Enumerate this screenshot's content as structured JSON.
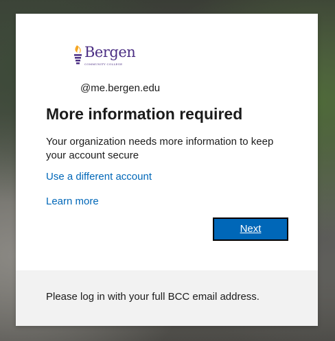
{
  "logo": {
    "name": "Bergen",
    "subtitle": "COMMUNITY COLLEGE",
    "brand_color": "#4b2e83",
    "flame_color": "#f5a623"
  },
  "account": {
    "email": "@me.bergen.edu"
  },
  "main": {
    "title": "More information required",
    "description": "Your organization needs more information to keep your account secure",
    "use_different_account": "Use a different account",
    "learn_more": "Learn more",
    "next_label": "Next"
  },
  "footer": {
    "text": "Please log in with your full BCC email address."
  },
  "colors": {
    "link": "#0067b8",
    "button": "#0067b8",
    "footer_bg": "#f2f2f2"
  }
}
